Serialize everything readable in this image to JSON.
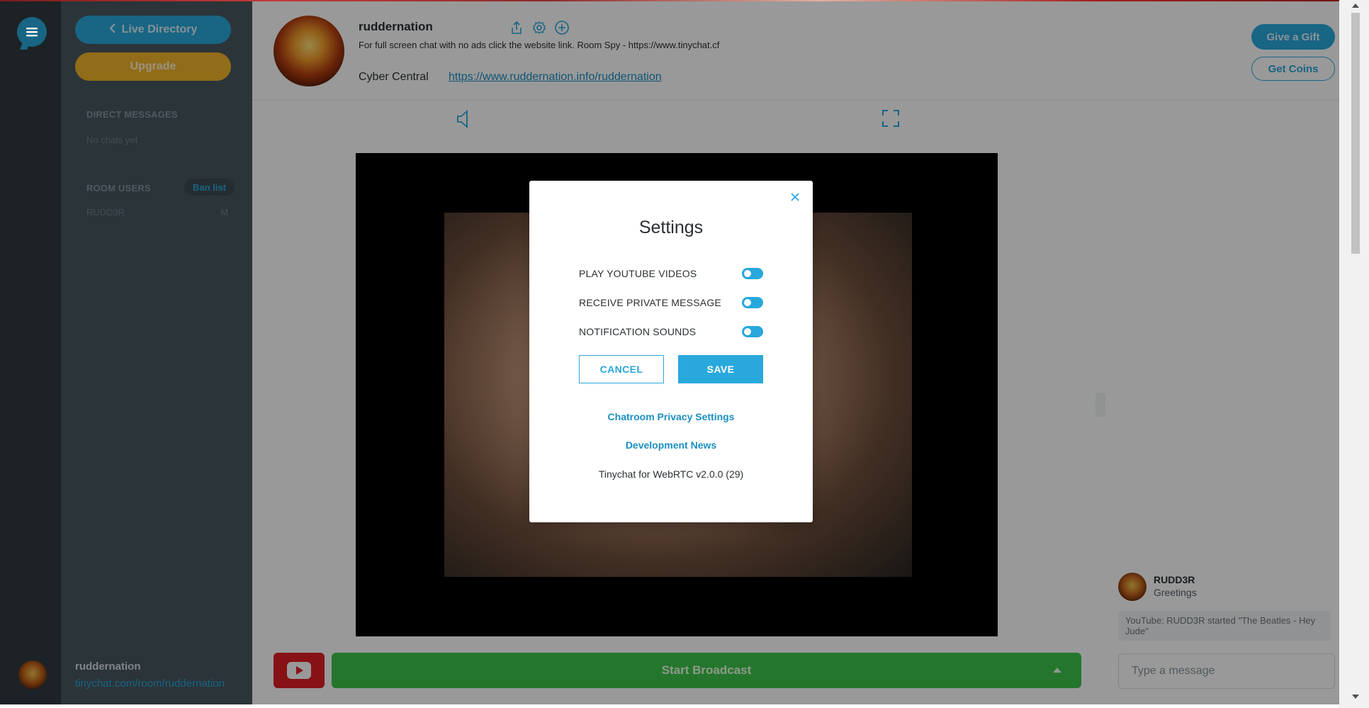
{
  "sidebar": {
    "live_directory_label": "Live Directory",
    "upgrade_label": "Upgrade",
    "direct_messages_heading": "DIRECT MESSAGES",
    "direct_messages_empty": "No chats yet",
    "room_users_heading": "ROOM USERS",
    "ban_list_label": "Ban list",
    "users": [
      {
        "name": "RUDD3R",
        "badge": "M"
      }
    ],
    "current_user": {
      "name": "ruddernation",
      "room_url": "tinychat.com/room/ruddernation"
    }
  },
  "header": {
    "room_name": "ruddernation",
    "description": "For full screen chat with no ads click the website link. Room Spy - https://www.tinychat.cf",
    "category": "Cyber Central",
    "website_link": "https://www.ruddernation.info/ruddernation",
    "give_gift_label": "Give a Gift",
    "get_coins_label": "Get Coins"
  },
  "controls": {
    "start_broadcast_label": "Start Broadcast"
  },
  "chat": {
    "messages": [
      {
        "user": "RUDD3R",
        "text": "Greetings"
      }
    ],
    "system_message": "YouTube: RUDD3R started \"The Beatles - Hey Jude\"",
    "input_placeholder": "Type a message"
  },
  "settings_modal": {
    "title": "Settings",
    "options": [
      {
        "label": "PLAY YOUTUBE VIDEOS",
        "enabled": true
      },
      {
        "label": "RECEIVE PRIVATE MESSAGE",
        "enabled": true
      },
      {
        "label": "NOTIFICATION SOUNDS",
        "enabled": true
      }
    ],
    "cancel_label": "CANCEL",
    "save_label": "SAVE",
    "privacy_link": "Chatroom Privacy Settings",
    "news_link": "Development News",
    "version": "Tinychat for WebRTC v2.0.0 (29)"
  },
  "colors": {
    "accent": "#29a8dc",
    "upgrade": "#f2b52a",
    "broadcast": "#3ec54b",
    "youtube": "#e21f26",
    "sidebar": "#48575f"
  }
}
